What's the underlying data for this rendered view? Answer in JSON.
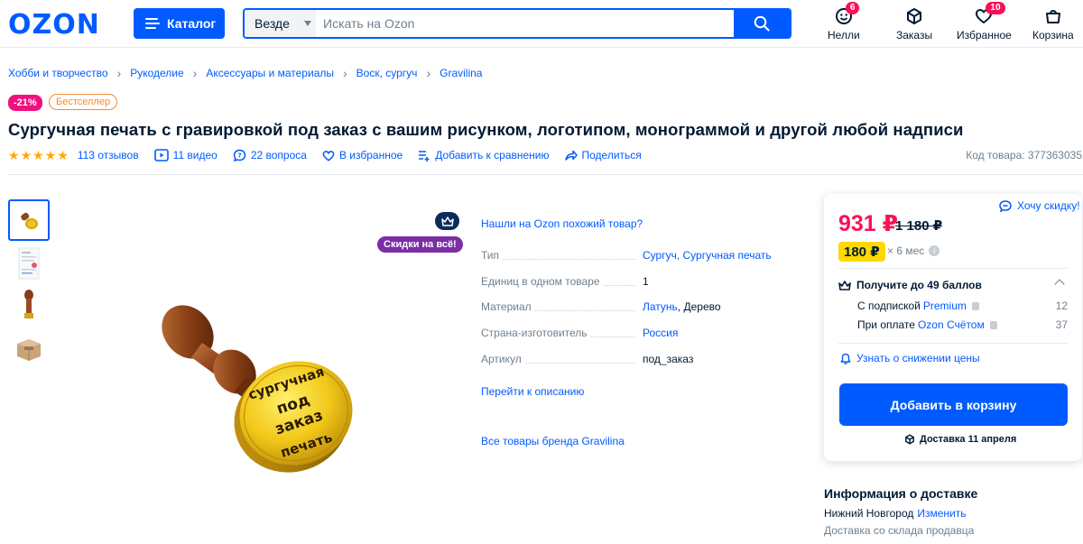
{
  "header": {
    "logo": "OZON",
    "catalog_label": "Каталог",
    "search_scope": "Везде",
    "search_placeholder": "Искать на Ozon",
    "nav": [
      {
        "label": "Нелли",
        "badge": "6",
        "icon": "face-icon"
      },
      {
        "label": "Заказы",
        "badge": "",
        "icon": "box-icon"
      },
      {
        "label": "Избранное",
        "badge": "10",
        "icon": "heart-icon"
      },
      {
        "label": "Корзина",
        "badge": "",
        "icon": "cart-icon"
      }
    ]
  },
  "breadcrumbs": [
    "Хобби и творчество",
    "Рукоделие",
    "Аксессуары и материалы",
    "Воск, сургуч",
    "Gravilina"
  ],
  "product": {
    "discount_tag": "-21%",
    "best_tag": "Бестселлер",
    "title": "Сургучная печать с гравировкой под заказ с вашим рисунком, логотипом, монограммой и другой любой надписи",
    "rating": 5,
    "reviews": "113 отзывов",
    "videos": "11 видео",
    "questions": "22 вопроса",
    "favorite": "В избранное",
    "compare": "Добавить к сравнению",
    "share": "Поделиться",
    "sku": "Код товара: 377363035",
    "sale_all": "Скидки на всё!",
    "stamp_text_top": "сургучная",
    "stamp_text_mid1": "под",
    "stamp_text_mid2": "заказ",
    "stamp_text_bottom": "печать"
  },
  "specs": {
    "similar": "Нашли на Ozon похожий товар?",
    "rows": [
      {
        "key": "Тип",
        "value": "",
        "link": "Сургуч, Сургучная печать"
      },
      {
        "key": "Единиц в одном товаре",
        "value": "1",
        "link": ""
      },
      {
        "key": "Материал",
        "value": ", Дерево",
        "link": "Латунь"
      },
      {
        "key": "Страна-изготовитель",
        "value": "",
        "link": "Россия"
      },
      {
        "key": "Артикул",
        "value": "под_заказ",
        "link": ""
      }
    ],
    "to_description": "Перейти к описанию",
    "brand_all": "Все товары бренда Gravilina"
  },
  "price_card": {
    "want_discount": "Хочу скидку!",
    "price": "931 ₽",
    "old_price": "1 180 ₽",
    "card_price": "180 ₽",
    "months": "× 6 мес",
    "points_title": "Получите до 49 баллов",
    "sub_label": "С подпиской",
    "sub_link": "Premium",
    "sub_value": "12",
    "pay_label": "При оплате",
    "pay_link": "Ozon Счётом",
    "pay_value": "37",
    "notify": "Узнать о снижении цены",
    "add_to_cart": "Добавить в корзину",
    "delivery": "Доставка 11 апреля"
  },
  "delivery_info": {
    "title": "Информация о доставке",
    "city": "Нижний Новгород",
    "change": "Изменить",
    "from_stock": "Доставка со склада продавца"
  },
  "colors": {
    "brand": "#005bff",
    "price": "#f91155",
    "card_price_bg": "#ffd900",
    "star": "#ffa800"
  }
}
